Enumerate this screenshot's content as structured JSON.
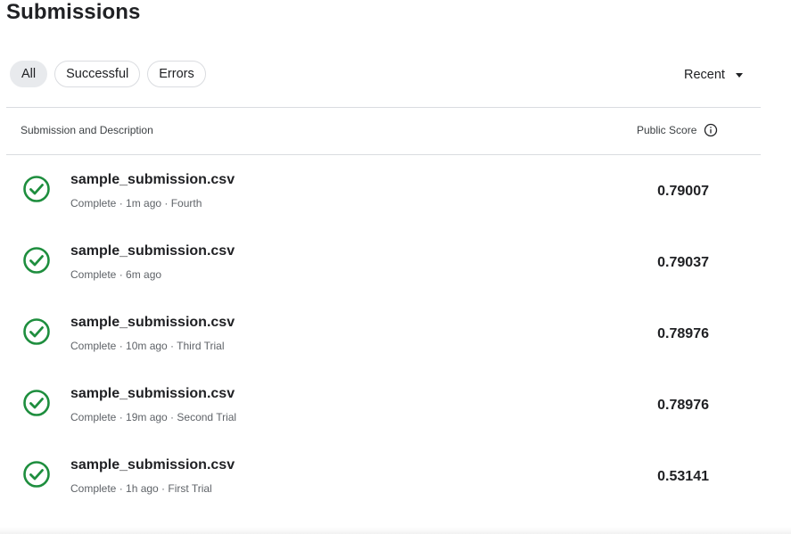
{
  "page": {
    "title": "Submissions"
  },
  "filters": [
    {
      "label": "All",
      "active": true
    },
    {
      "label": "Successful",
      "active": false
    },
    {
      "label": "Errors",
      "active": false
    }
  ],
  "sort": {
    "label": "Recent",
    "icon": "caret-down-icon"
  },
  "table": {
    "header_left": "Submission and Description",
    "header_right": "Public Score",
    "header_icon": "info-icon"
  },
  "colors": {
    "success": "#1e8e3e",
    "divider": "#dadce0"
  },
  "rows": [
    {
      "file": "sample_submission.csv",
      "status": "Complete · 1m ago · Fourth",
      "score": "0.79007",
      "icon": "check-circle-icon"
    },
    {
      "file": "sample_submission.csv",
      "status": "Complete · 6m ago",
      "score": "0.79037",
      "icon": "check-circle-icon"
    },
    {
      "file": "sample_submission.csv",
      "status": "Complete · 10m ago · Third Trial",
      "score": "0.78976",
      "icon": "check-circle-icon"
    },
    {
      "file": "sample_submission.csv",
      "status": "Complete · 19m ago · Second Trial",
      "score": "0.78976",
      "icon": "check-circle-icon"
    },
    {
      "file": "sample_submission.csv",
      "status": "Complete · 1h ago · First Trial",
      "score": "0.53141",
      "icon": "check-circle-icon"
    }
  ]
}
